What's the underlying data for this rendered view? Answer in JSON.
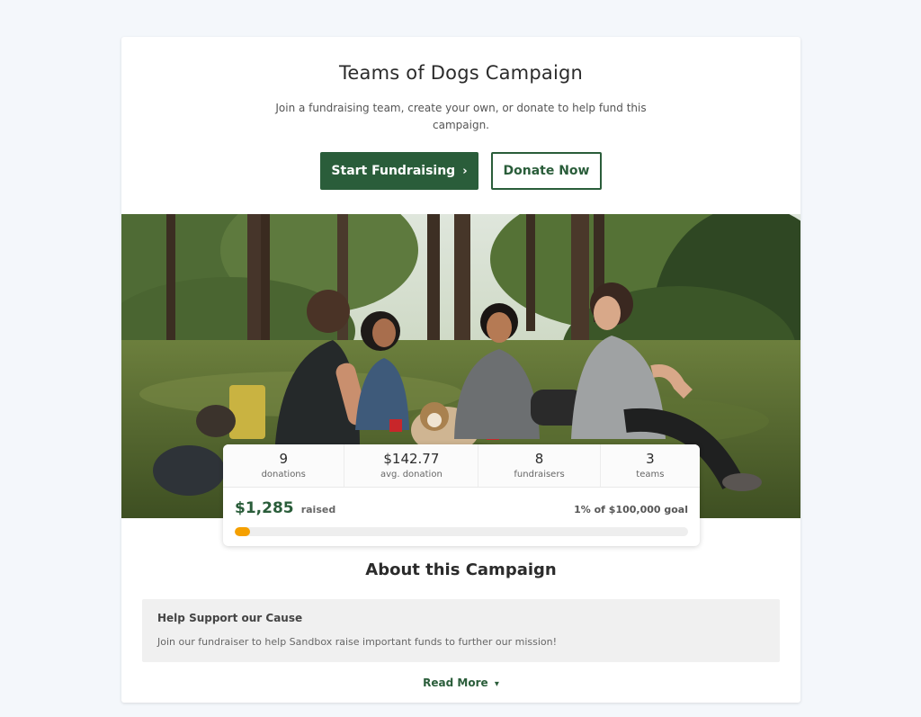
{
  "campaign": {
    "title": "Teams of Dogs Campaign",
    "subtitle": "Join a fundraising team, create your own, or donate to help fund this campaign."
  },
  "actions": {
    "start_fundraising": "Start Fundraising",
    "donate_now": "Donate Now"
  },
  "hero_image": {
    "alt": "Four friends sitting on the grass in a park with a dog"
  },
  "stats": [
    {
      "value": "9",
      "label": "donations"
    },
    {
      "value": "$142.77",
      "label": "avg. donation"
    },
    {
      "value": "8",
      "label": "fundraisers"
    },
    {
      "value": "3",
      "label": "teams"
    }
  ],
  "progress": {
    "raised_amount": "$1,285",
    "raised_label": "raised",
    "goal_text": "1% of $100,000 goal",
    "percent": 1
  },
  "about": {
    "title": "About this Campaign",
    "cause_title": "Help Support our Cause",
    "cause_text": "Join our fundraiser to help Sandbox raise important funds to further our mission!",
    "read_more": "Read More"
  },
  "colors": {
    "brand_green": "#2a5d3a",
    "progress_orange": "#f5a000",
    "page_bg": "#f4f7fb"
  },
  "icons": {
    "start_chevron": "chevron-right-icon",
    "read_more_chevron": "chevron-down-icon"
  }
}
